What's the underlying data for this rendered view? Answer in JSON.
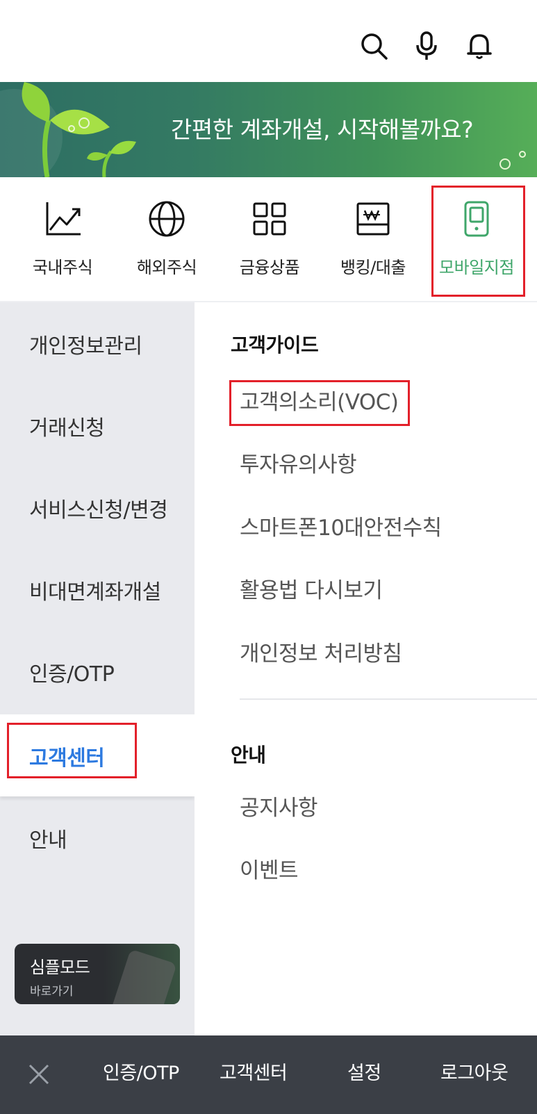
{
  "header": {
    "icons": [
      "search-icon",
      "microphone-icon",
      "bell-icon"
    ]
  },
  "banner": {
    "text": "간편한 계좌개설, 시작해볼까요?"
  },
  "categories": [
    {
      "label": "국내주식",
      "icon": "chart-up-icon"
    },
    {
      "label": "해외주식",
      "icon": "globe-icon"
    },
    {
      "label": "금융상품",
      "icon": "grid-icon"
    },
    {
      "label": "뱅킹/대출",
      "icon": "won-bill-icon"
    },
    {
      "label": "모바일지점",
      "icon": "mobile-phone-icon",
      "active": true
    }
  ],
  "sidebar": {
    "items": [
      {
        "label": "개인정보관리"
      },
      {
        "label": "거래신청"
      },
      {
        "label": "서비스신청/변경"
      },
      {
        "label": "비대면계좌개설"
      },
      {
        "label": "인증/OTP"
      },
      {
        "label": "고객센터",
        "active": true
      },
      {
        "label": "안내"
      }
    ],
    "simple_mode": {
      "title": "심플모드",
      "subtitle": "바로가기"
    }
  },
  "content": {
    "sections": [
      {
        "title": "고객가이드",
        "links": [
          "고객의소리(VOC)",
          "투자유의사항",
          "스마트폰10대안전수칙",
          "활용법 다시보기",
          "개인정보 처리방침"
        ]
      },
      {
        "title": "안내",
        "links": [
          "공지사항",
          "이벤트"
        ]
      }
    ]
  },
  "bottom_bar": {
    "items": [
      "인증/OTP",
      "고객센터",
      "설정",
      "로그아웃"
    ]
  },
  "colors": {
    "accent_green": "#3fa66a",
    "accent_blue": "#2d7ae0",
    "highlight_red": "#e3202a",
    "bottom_bar": "#3b3f46"
  }
}
